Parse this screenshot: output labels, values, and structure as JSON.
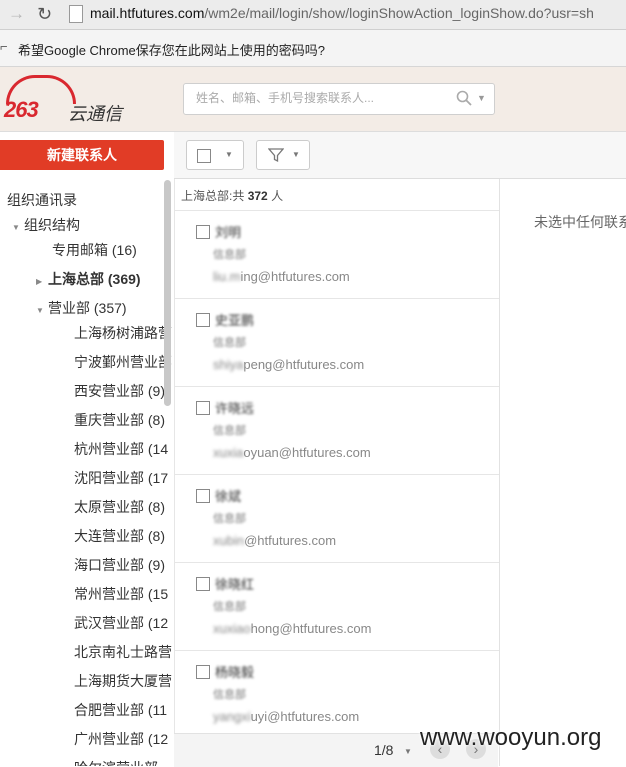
{
  "browser": {
    "url_host": "mail.htfutures.com",
    "url_path": "/wm2e/mail/login/show/loginShowAction_loginShow.do?usr=sh"
  },
  "password_bar": {
    "text": "希望Google Chrome保存您在此网站上使用的密码吗?"
  },
  "header": {
    "logo_number": "263",
    "logo_name": "云通信",
    "search_placeholder": "姓名、邮箱、手机号搜索联系人..."
  },
  "toolbar": {
    "new_contact_label": "新建联系人"
  },
  "sidebar": {
    "root": "组织通讯录",
    "org_structure": "组织结构",
    "items": [
      {
        "label": "专用邮箱 (16)"
      },
      {
        "label": "上海总部 (369)"
      },
      {
        "label": "营业部 (357)"
      }
    ],
    "branches": [
      "上海杨树浦路营",
      "宁波鄞州营业部",
      "西安营业部 (9)",
      "重庆营业部 (8)",
      "杭州营业部 (14",
      "沈阳营业部 (17",
      "太原营业部 (8)",
      "大连营业部 (8)",
      "海口营业部 (9)",
      "常州营业部 (15",
      "武汉营业部 (12",
      "北京南礼士路营",
      "上海期货大厦营",
      "合肥营业部 (11",
      "广州营业部 (12",
      "哈尔滨营业部"
    ]
  },
  "list": {
    "header_prefix": "上海总部:共",
    "count": "372",
    "header_suffix": "人",
    "contacts": [
      {
        "name": "刘明",
        "dept": "信息部",
        "email_hidden": "liu.m",
        "email_visible": "ing@htfutures.com"
      },
      {
        "name": "史亚鹏",
        "dept": "信息部",
        "email_hidden": "shiya",
        "email_visible": "peng@htfutures.com"
      },
      {
        "name": "许晓远",
        "dept": "信息部",
        "email_hidden": "xuxia",
        "email_visible": "oyuan@htfutures.com"
      },
      {
        "name": "徐斌",
        "dept": "信息部",
        "email_hidden": "xubin",
        "email_visible": "@htfutures.com"
      },
      {
        "name": "徐晓红",
        "dept": "信息部",
        "email_hidden": "xuxiao",
        "email_visible": "hong@htfutures.com"
      },
      {
        "name": "杨晓毅",
        "dept": "信息部",
        "email_hidden": "yangxi",
        "email_visible": "uyi@htfutures.com"
      }
    ]
  },
  "pager": {
    "text": "1/8"
  },
  "detail": {
    "empty_text": "未选中任何联系"
  },
  "watermark": "www.wooyun.org"
}
